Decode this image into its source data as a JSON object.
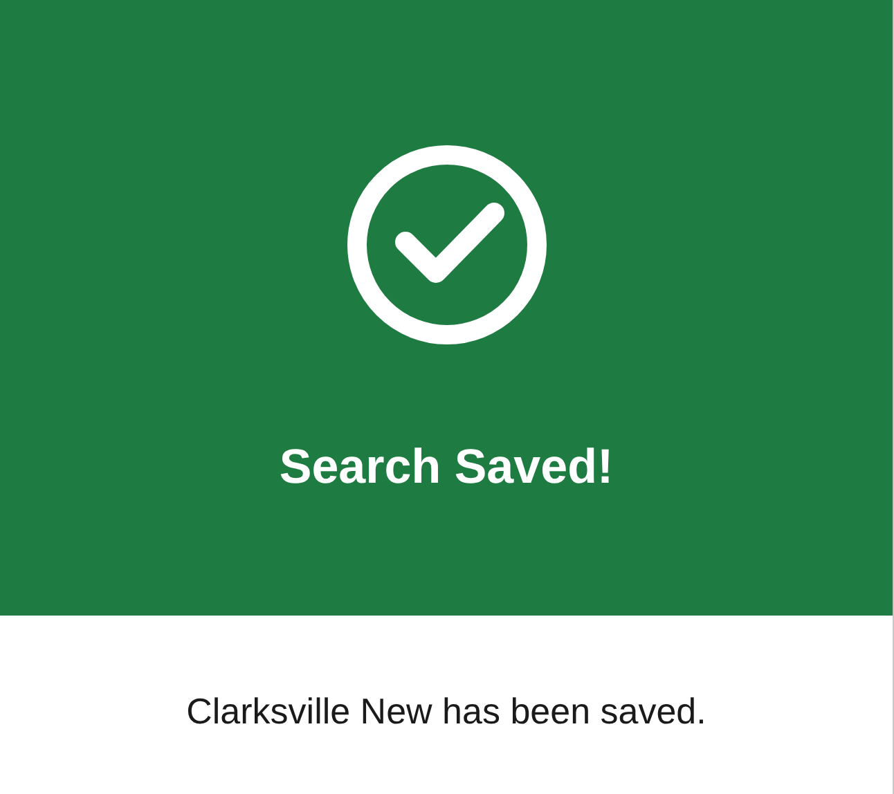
{
  "header": {
    "title": "Search Saved!"
  },
  "message": "Clarksville New has been saved."
}
